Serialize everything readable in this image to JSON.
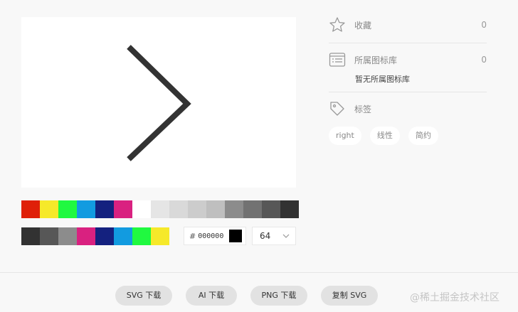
{
  "preview": {
    "glyph": "chevron-right",
    "stroke": "#333333"
  },
  "palette": {
    "row1": [
      "#df2009",
      "#f6e92a",
      "#20f940",
      "#129be0",
      "#14217f",
      "#d92180",
      "#ffffff",
      "#e5e5e5",
      "#d9d9d9",
      "#cccccc",
      "#bfbfbf",
      "#8c8c8c",
      "#727272",
      "#575757",
      "#323232"
    ],
    "row2": [
      "#323232",
      "#575757",
      "#8c8c8c",
      "#d92180",
      "#14217f",
      "#129be0",
      "#20f940",
      "#f6e92a"
    ]
  },
  "color_input": {
    "hash": "#",
    "value": "000000",
    "chip": "#000000"
  },
  "size_select": {
    "value": "64"
  },
  "side": {
    "favorite": {
      "label": "收藏",
      "count": "0"
    },
    "library": {
      "label": "所属图标库",
      "count": "0",
      "empty_note": "暂无所属图标库"
    },
    "tags": {
      "label": "标签",
      "items": [
        "right",
        "线性",
        "简约"
      ]
    }
  },
  "footer": {
    "buttons": [
      "SVG 下载",
      "AI 下载",
      "PNG 下载",
      "复制 SVG"
    ],
    "watermark": "@稀土掘金技术社区"
  }
}
